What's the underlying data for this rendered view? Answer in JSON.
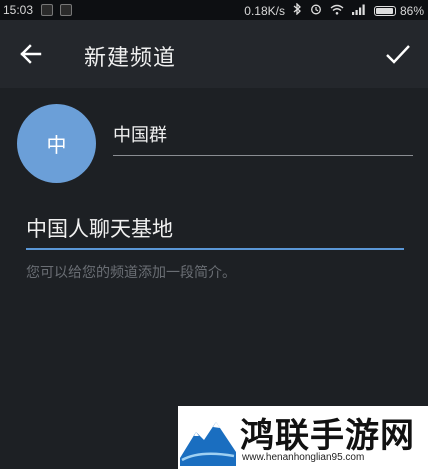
{
  "status_bar": {
    "time": "15:03",
    "net_speed": "0.18K/s",
    "battery": "86%",
    "icons": [
      "bluetooth-icon",
      "alarm-icon",
      "wifi-icon",
      "signal-icon",
      "battery-icon"
    ]
  },
  "toolbar": {
    "title": "新建频道",
    "back_icon": "arrow-left-icon",
    "done_icon": "check-icon"
  },
  "form": {
    "avatar_letter": "中",
    "avatar_color": "#6b9fd8",
    "name_value": "中国群",
    "description_value": "中国人聊天基地",
    "hint": "您可以给您的频道添加一段简介。",
    "accent_color": "#5b97d6"
  },
  "watermark": {
    "title": "鸿联手游网",
    "url": "www.henanhonglian95.com"
  }
}
